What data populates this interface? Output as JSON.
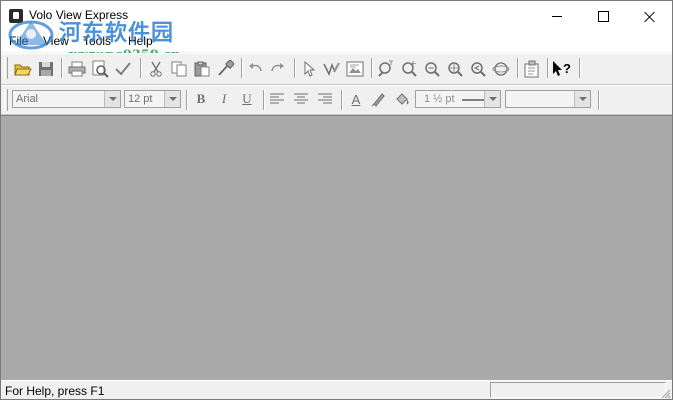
{
  "window": {
    "title": "Volo View Express"
  },
  "watermark": {
    "title": "河东软件园",
    "url": "www.pc0359.cn"
  },
  "menu": {
    "items": [
      "File",
      "View",
      "Tools",
      "Help"
    ]
  },
  "format": {
    "font": "Arial",
    "size": "12 pt",
    "bold": "B",
    "italic": "I",
    "underline": "U",
    "text_color": "A",
    "line_weight": "1 ½ pt",
    "line_style": ""
  },
  "status": {
    "text": "For Help, press F1"
  },
  "colors": {
    "workspace": "#a9a9a9",
    "watermark_blue": "#2f7fd2",
    "watermark_green": "#33a04a"
  }
}
